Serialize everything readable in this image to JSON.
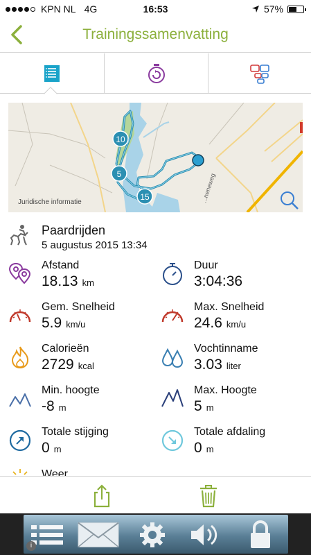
{
  "status_bar": {
    "carrier": "KPN NL",
    "network": "4G",
    "time": "16:53",
    "battery": "57%",
    "battery_level": 0.57
  },
  "nav": {
    "title": "Trainingssamenvatting"
  },
  "map": {
    "info_label": "Juridische informatie",
    "road_label": "...neneweg",
    "markers": [
      "10",
      "5",
      "15"
    ]
  },
  "activity": {
    "name": "Paardrijden",
    "date": "5 augustus 2015 13:34"
  },
  "stats": [
    {
      "label": "Afstand",
      "value": "18.13",
      "unit": "km"
    },
    {
      "label": "Duur",
      "value": "3:04:36",
      "unit": ""
    },
    {
      "label": "Gem. Snelheid",
      "value": "5.9",
      "unit": "km/u"
    },
    {
      "label": "Max. Snelheid",
      "value": "24.6",
      "unit": "km/u"
    },
    {
      "label": "Calorieën",
      "value": "2729",
      "unit": "kcal"
    },
    {
      "label": "Vochtinname",
      "value": "3.03",
      "unit": "liter"
    },
    {
      "label": "Min. hoogte",
      "value": "-8",
      "unit": "m"
    },
    {
      "label": "Max. Hoogte",
      "value": "5",
      "unit": "m"
    },
    {
      "label": "Totale stijging",
      "value": "0",
      "unit": "m"
    },
    {
      "label": "Totale afdaling",
      "value": "0",
      "unit": "m"
    }
  ],
  "weather": {
    "label": "Weer"
  },
  "colors": {
    "accent_green": "#8cb03c",
    "accent_teal": "#19a3c9",
    "route": "#2b8fb2"
  }
}
